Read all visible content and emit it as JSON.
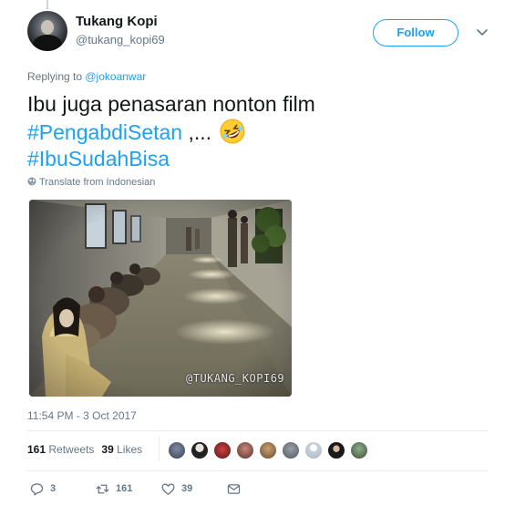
{
  "tweet": {
    "author": {
      "display_name": "Tukang Kopi",
      "handle": "@tukang_kopi69"
    },
    "follow_label": "Follow",
    "reply_prefix": "Replying to ",
    "reply_to": "@jokoanwar",
    "text_plain": "Ibu juga penasaran nonton film",
    "hashtag_1": "#PengabdiSetan",
    "text_after": " ,... ",
    "hashtag_2": "#IbuSudahBisa",
    "emoji": "rolling-on-floor-laughing",
    "translate_label": "Translate from Indonesian",
    "photo_watermark": "@TUKANG_KOPI69",
    "timestamp": "11:54 PM - 3 Oct 2017",
    "retweets_count": "161",
    "retweets_label": "Retweets",
    "likes_count": "39",
    "likes_label": "Likes",
    "liker_avatar_count": 9,
    "actions": {
      "reply_count": "3",
      "retweet_count": "161",
      "like_count": "39"
    }
  },
  "colors": {
    "link_blue": "#1da1f2",
    "secondary_text": "#657786",
    "primary_text": "#14171a",
    "divider": "#e6ecf0"
  },
  "icons": [
    "chevron-down-icon",
    "globe-icon",
    "reply-icon",
    "retweet-icon",
    "heart-icon",
    "message-icon"
  ]
}
